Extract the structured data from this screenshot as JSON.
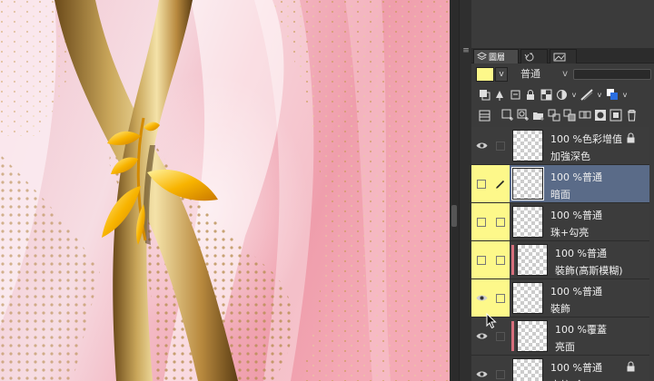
{
  "app": {
    "window_title": ""
  },
  "panel": {
    "tabs": [
      {
        "label": "圖層",
        "icon": "layers-icon",
        "active": true
      },
      {
        "label": "",
        "icon": "history-icon",
        "active": false
      },
      {
        "label": "",
        "icon": "navigator-icon",
        "active": false
      }
    ],
    "blend_mode": "普通",
    "main_color": "#fdf88a"
  },
  "layers": [
    {
      "opacity": "100 %",
      "mode": "色彩增值",
      "name": "加強深色",
      "visible": true,
      "yellow": false,
      "selected": false,
      "locked": true,
      "clip_flag": false,
      "edit": false
    },
    {
      "opacity": "100 %",
      "mode": "普通",
      "name": "暗面",
      "visible": false,
      "yellow": true,
      "selected": true,
      "locked": false,
      "clip_flag": false,
      "edit": true
    },
    {
      "opacity": "100 %",
      "mode": "普通",
      "name": "珠+勾亮",
      "visible": false,
      "yellow": true,
      "selected": false,
      "locked": false,
      "clip_flag": false,
      "edit": false
    },
    {
      "opacity": "100 %",
      "mode": "普通",
      "name": "裝飾(高斯模糊)",
      "visible": false,
      "yellow": true,
      "selected": false,
      "locked": false,
      "clip_flag": true,
      "edit": false
    },
    {
      "opacity": "100 %",
      "mode": "普通",
      "name": "裝飾",
      "visible": true,
      "yellow": true,
      "selected": false,
      "locked": false,
      "clip_flag": false,
      "edit": false
    },
    {
      "opacity": "100 %",
      "mode": "覆蓋",
      "name": "亮面",
      "visible": true,
      "yellow": false,
      "selected": false,
      "locked": false,
      "clip_flag": true,
      "edit": false
    },
    {
      "opacity": "100 %",
      "mode": "普通",
      "name": "衣紋(金)",
      "visible": true,
      "yellow": false,
      "selected": false,
      "locked": true,
      "clip_flag": false,
      "edit": false
    }
  ],
  "colors": {
    "selected_row": "#5a6b88",
    "yellow_mark": "#fdf88a",
    "clip_flag": "#d56e7c"
  }
}
